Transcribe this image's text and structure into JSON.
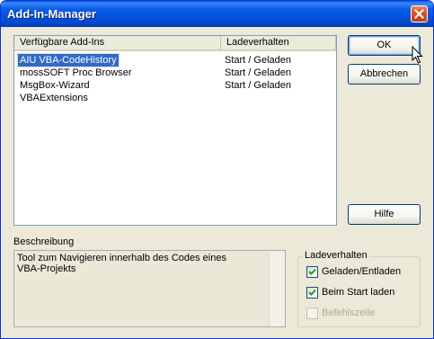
{
  "window": {
    "title": "Add-In-Manager"
  },
  "list": {
    "columns": [
      "Verfügbare Add-Ins",
      "Ladeverhalten"
    ],
    "rows": [
      {
        "name": "AIU VBA-CodeHistory",
        "load": "Start / Geladen",
        "selected": true
      },
      {
        "name": "mossSOFT Proc Browser",
        "load": "Start / Geladen",
        "selected": false
      },
      {
        "name": "MsgBox-Wizard",
        "load": "Start / Geladen",
        "selected": false
      },
      {
        "name": "VBAExtensions",
        "load": "",
        "selected": false
      }
    ]
  },
  "buttons": {
    "ok": "OK",
    "cancel": "Abbrechen",
    "help": "Hilfe"
  },
  "description": {
    "label": "Beschreibung",
    "text": "Tool zum Navigieren innerhalb des Codes eines\nVBA-Projekts"
  },
  "load_behavior": {
    "title": "Ladeverhalten",
    "loaded": {
      "label": "Geladen/Entladen",
      "checked": true
    },
    "startup": {
      "label": "Beim Start laden",
      "checked": true
    },
    "command_line": {
      "label": "Befehlszeile",
      "checked": false,
      "disabled": true
    }
  },
  "icons": {
    "close": "close-icon",
    "check": "checkmark-icon",
    "cursor": "mouse-cursor-icon"
  }
}
